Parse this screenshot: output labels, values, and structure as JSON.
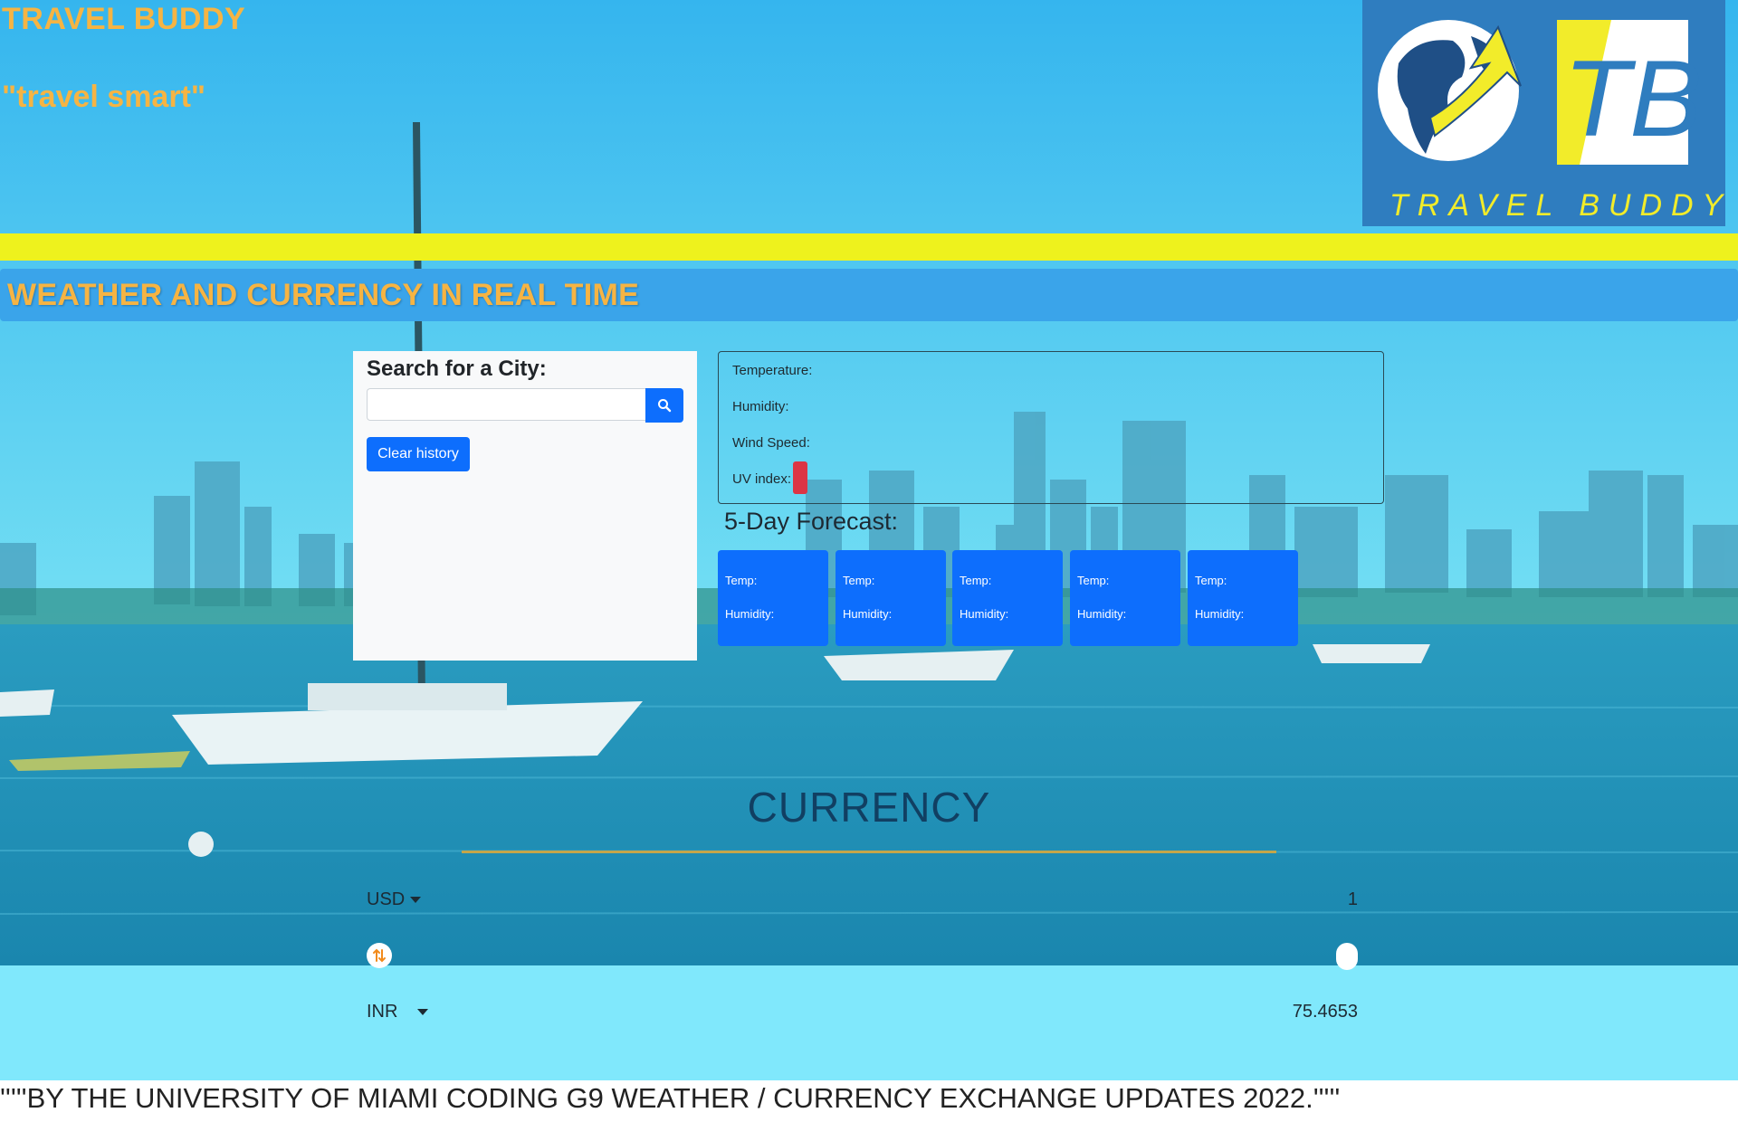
{
  "header": {
    "title": "TRAVEL BUDDY",
    "tagline": "\"travel smart\"",
    "logo": {
      "monogram": "TB",
      "wordmark": "TRAVEL BUDDY"
    }
  },
  "banner": {
    "title": "WEATHER AND CURRENCY IN REAL TIME"
  },
  "search": {
    "heading": "Search for a City:",
    "input_value": "",
    "placeholder": "",
    "search_icon": "search-icon",
    "clear_label": "Clear history"
  },
  "weather": {
    "temperature_label": "Temperature:",
    "humidity_label": "Humidity:",
    "wind_label": "Wind Speed:",
    "uv_label": "UV index:"
  },
  "forecast": {
    "heading": "5-Day Forecast:",
    "cards": [
      {
        "temp": "Temp:",
        "humidity": "Humidity:"
      },
      {
        "temp": "Temp:",
        "humidity": "Humidity:"
      },
      {
        "temp": "Temp:",
        "humidity": "Humidity:"
      },
      {
        "temp": "Temp:",
        "humidity": "Humidity:"
      },
      {
        "temp": "Temp:",
        "humidity": "Humidity:"
      }
    ]
  },
  "currency": {
    "title": "CURRENCY",
    "from_code": "USD",
    "from_amount": "1",
    "to_code": "INR",
    "to_amount": "75.4653",
    "swap_icon": "swap-arrows-icon"
  },
  "footer": {
    "text": "'''''BY THE UNIVERSITY OF MIAMI CODING G9 WEATHER / CURRENCY EXCHANGE UPDATES 2022.'''''"
  },
  "colors": {
    "accent_orange": "#f6b443",
    "highlight_yellow": "#eef21d",
    "primary_blue": "#0d6efd",
    "banner_blue": "#3aa4ea",
    "uv_red": "#dc3545",
    "currency_navy": "#113f62"
  }
}
